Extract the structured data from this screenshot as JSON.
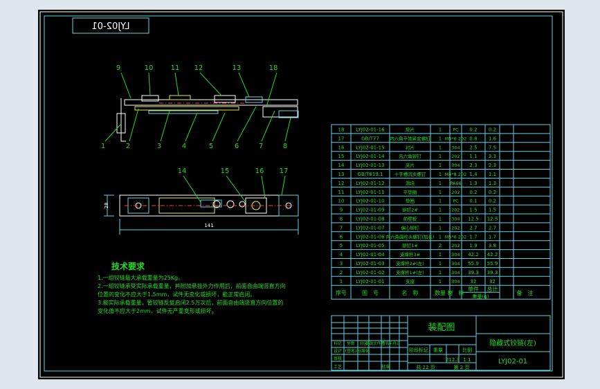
{
  "drawing": {
    "stamp_code": "LYJ02-01",
    "title_cn": "装配图",
    "product_name": "隐藏式铰链(左)",
    "drawing_no": "LYJ02-01",
    "scale": "1:1",
    "weight": "212.3",
    "sheets": "共 22 页",
    "sheet_no": "第 2 页"
  },
  "callouts": {
    "top": [
      "9",
      "10",
      "11",
      "12",
      "13",
      "18"
    ],
    "bottom": [
      "1",
      "2",
      "3",
      "4",
      "5",
      "6",
      "7",
      "8"
    ],
    "plan": [
      "14",
      "15",
      "16",
      "17"
    ]
  },
  "dimensions": {
    "length": "141",
    "height": "28"
  },
  "tech": {
    "heading": "技术要求",
    "items": [
      "1.一组铰链最大承载重量为25Kg。",
      "2.一组铰链承受实际承载重量，并附加悬挂外力作用后，前面自由端竖直方向",
      "  位置的变化不应大于1.5mm，试件无变化或损坏，能正常启闭。",
      "3.按实际承载重量，暂铰链反复启闭2.5万次后，前面自由端竖直方向位置的",
      "  变化值不应大于2mm，试件无严重变形或损坏。"
    ]
  },
  "bom": {
    "headers": [
      "序号",
      "图　号",
      "名　称",
      "数量",
      "材　料",
      "单件",
      "总计",
      "备　注"
    ],
    "weight_label": "重量(g)",
    "rows": [
      [
        "18",
        "LYJ02-01-16",
        "垫片",
        "1",
        "PC",
        "0.2",
        "0.2",
        ""
      ],
      [
        "17",
        "GB/T77",
        "内六角平端紧定螺钉",
        "1",
        "M5*6 202",
        "0.8",
        "1.6",
        ""
      ],
      [
        "16",
        "LYJ02-01-15",
        "衬片",
        "1",
        "304",
        "2.5",
        "7.5",
        ""
      ],
      [
        "15",
        "LYJ02-01-14",
        "内六角铆钉",
        "1",
        "202",
        "1.1",
        "3.3",
        ""
      ],
      [
        "14",
        "LYJ02-01-13",
        "夹片",
        "1",
        "304",
        "2.3",
        "2.3",
        ""
      ],
      [
        "13",
        "GB/T819.1",
        "十字槽沉头螺钉",
        "1",
        "M4*8 202",
        "1.4",
        "1.1",
        ""
      ],
      [
        "12",
        "LYJ02-01-12",
        "滑块",
        "1",
        "PA66",
        "1.3",
        "1.3",
        ""
      ],
      [
        "11",
        "LYJ02-01-11",
        "平垫圈",
        "1",
        "202",
        "0.2",
        "0.2",
        ""
      ],
      [
        "10",
        "LYJ02-01-10",
        "垫圈",
        "1",
        "PC",
        "0.1",
        "0.2",
        ""
      ],
      [
        "9",
        "LYJ02-01-09",
        "铆钉2#",
        "1",
        "202",
        "1.5",
        "1.5",
        ""
      ],
      [
        "8",
        "LYJ02-01-08",
        "前壁板",
        "1",
        "304",
        "12.5",
        "12.5",
        ""
      ],
      [
        "7",
        "LYJ02-01-07",
        "偏心铆钉",
        "1",
        "202",
        "2.7",
        "2.7",
        ""
      ],
      [
        "6",
        "LYJ02-01-06",
        "内六角圆柱头螺钉(加长)",
        "1",
        "M5*6 202",
        "1.7",
        "1.7",
        ""
      ],
      [
        "5",
        "LYJ02-01-05",
        "铆钉1#",
        "2",
        "202",
        "1.9",
        "3.8",
        ""
      ],
      [
        "4",
        "LYJ02-01-04",
        "支撑杆3#",
        "1",
        "304",
        "42.2",
        "42.2",
        ""
      ],
      [
        "3",
        "LYJ02-01-03",
        "支撑杆2#(左)",
        "1",
        "304",
        "55.9",
        "55.9",
        ""
      ],
      [
        "2",
        "LYJ02-01-02",
        "支撑杆1#(左)",
        "1",
        "304",
        "39.3",
        "39.3",
        ""
      ],
      [
        "1",
        "LYJ02-01-01",
        "支座",
        "1",
        "304",
        "32",
        "32",
        ""
      ]
    ]
  },
  "titleblock": {
    "r1": [
      "标记",
      "处数",
      "分区",
      "更改文件号",
      "签名",
      "年月日"
    ],
    "r2": [
      "设计",
      "(签名)",
      "标准化"
    ],
    "r3": [
      "审核"
    ],
    "r4": [
      "工艺",
      "",
      "批准"
    ],
    "stage": [
      "阶段标记",
      "重量",
      "比例"
    ]
  }
}
